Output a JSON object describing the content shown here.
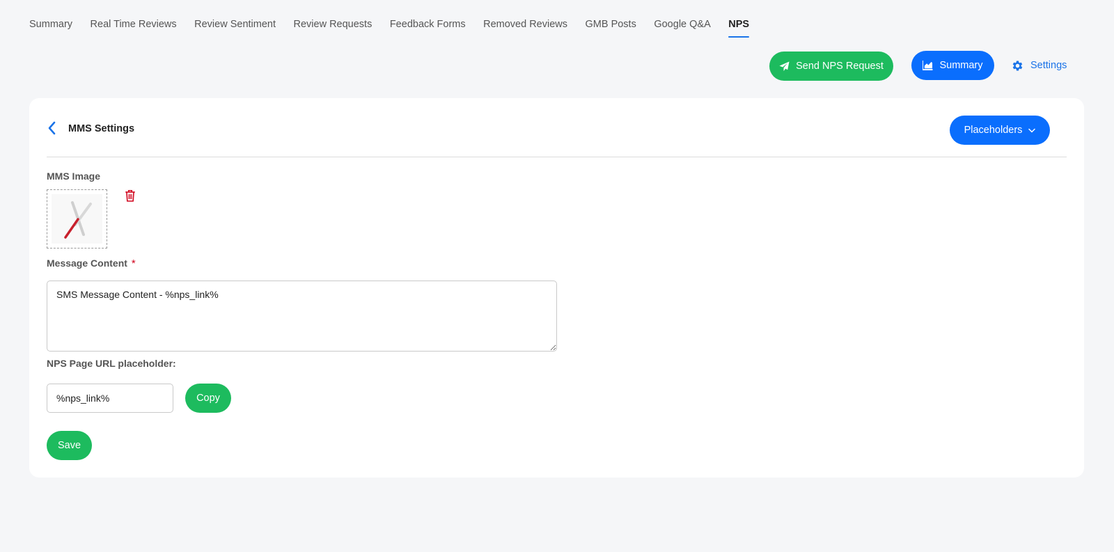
{
  "tabs": [
    {
      "label": "Summary"
    },
    {
      "label": "Real Time Reviews"
    },
    {
      "label": "Review Sentiment"
    },
    {
      "label": "Review Requests"
    },
    {
      "label": "Feedback Forms"
    },
    {
      "label": "Removed Reviews"
    },
    {
      "label": "GMB Posts"
    },
    {
      "label": "Google Q&A"
    },
    {
      "label": "NPS",
      "active": true
    }
  ],
  "actions": {
    "send_nps_label": "Send NPS Request",
    "summary_label": "Summary",
    "settings_label": "Settings"
  },
  "card": {
    "title": "MMS Settings",
    "placeholders_label": "Placeholders",
    "mms_image_label": "MMS Image",
    "message_content_label": "Message Content",
    "required_mark": "*",
    "message_content_value": "SMS Message Content - %nps_link%",
    "url_placeholder_label": "NPS Page URL placeholder:",
    "url_placeholder_value": "%nps_link%",
    "copy_label": "Copy",
    "save_label": "Save"
  },
  "colors": {
    "green": "#1dbb5e",
    "blue": "#0a6efd",
    "link_blue": "#1a73e8",
    "danger": "#d0021b"
  },
  "icons": [
    "paper-plane-icon",
    "chart-icon",
    "gear-icon",
    "chevron-left-icon",
    "chevron-down-icon",
    "trash-icon",
    "image-placeholder-icon"
  ]
}
